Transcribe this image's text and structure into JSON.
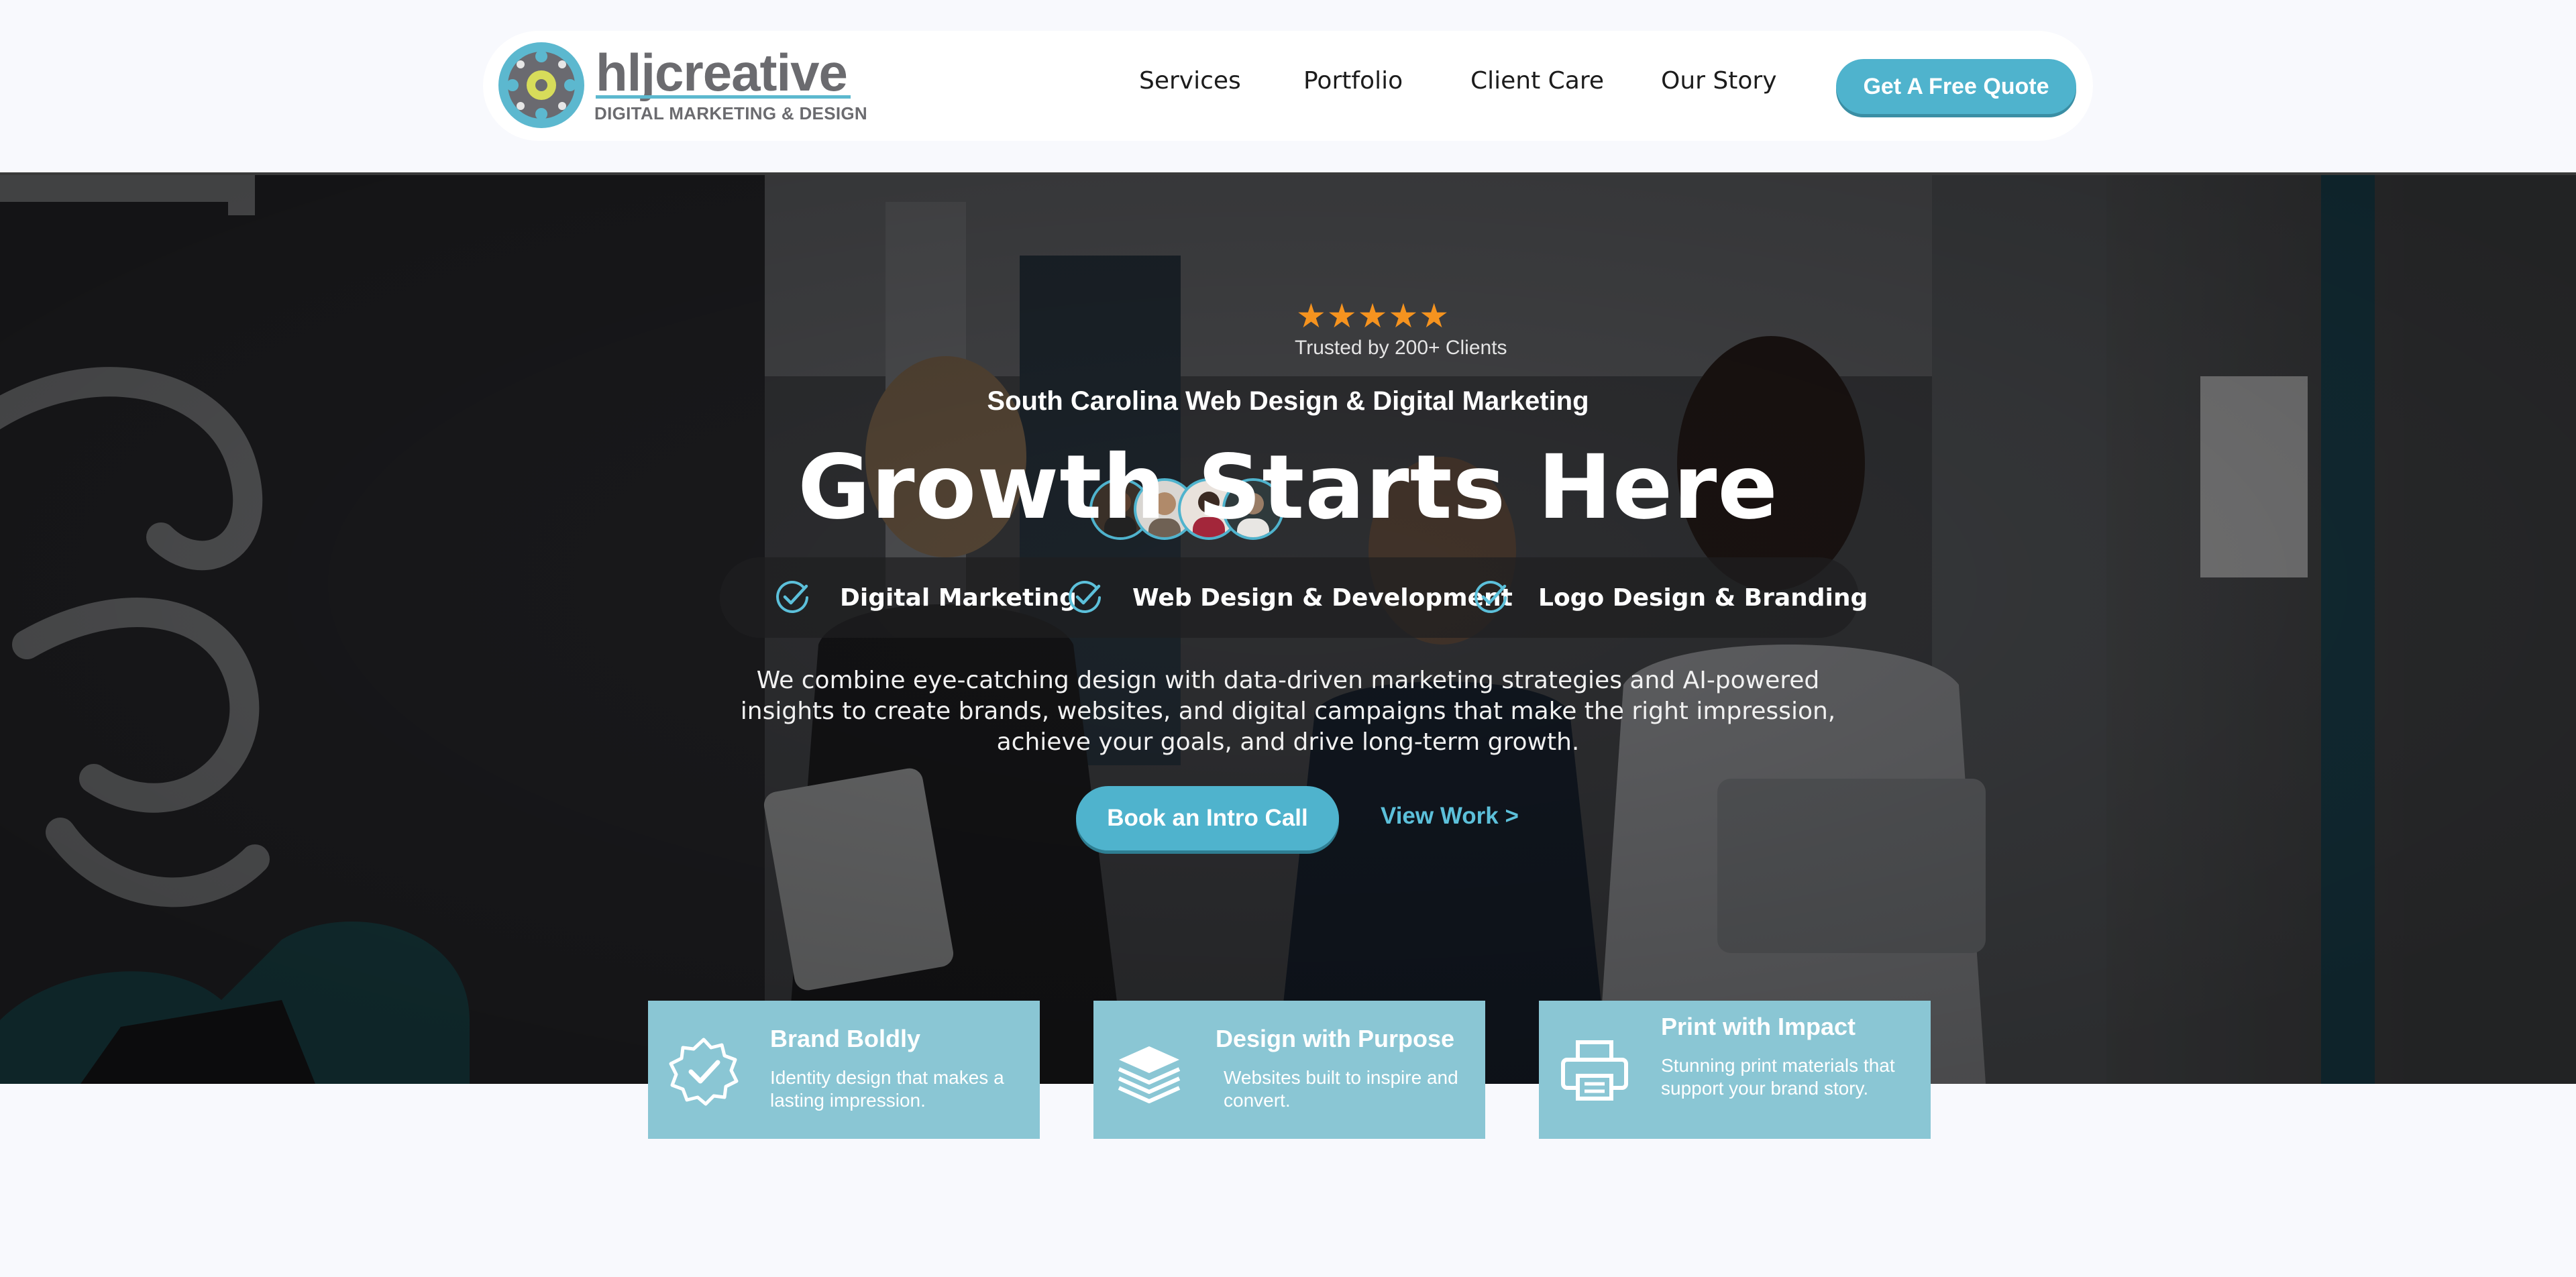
{
  "brand": {
    "name": "hljcreative",
    "tagline": "DIGITAL MARKETING & DESIGN",
    "accent_color": "#4fb3cd",
    "logo_icon": "film-reel-logo-icon"
  },
  "nav": {
    "items": [
      {
        "label": "Services"
      },
      {
        "label": "Portfolio"
      },
      {
        "label": "Client Care"
      },
      {
        "label": "Our Story"
      }
    ],
    "cta_label": "Get A Free Quote"
  },
  "hero": {
    "rating": {
      "stars": 5,
      "star_glyphs": "★★★★★",
      "label": "Trusted by 200+ Clients",
      "avatar_count": 4
    },
    "eyebrow": "South Carolina Web Design & Digital Marketing",
    "headline": "Growth Starts Here",
    "services": [
      {
        "label": "Digital Marketing",
        "icon": "check-circle-icon"
      },
      {
        "label": "Web Design & Development",
        "icon": "check-circle-icon"
      },
      {
        "label": "Logo Design & Branding",
        "icon": "check-circle-icon"
      }
    ],
    "description": "We combine eye-catching design with data-driven marketing strategies and AI-powered insights to create brands, websites, and digital campaigns that make the right impression, achieve your goals, and drive long-term growth.",
    "primary_cta": "Book an Intro Call",
    "secondary_cta": "View Work >"
  },
  "features": [
    {
      "title": "Brand Boldly",
      "text": "Identity design that makes a lasting impression.",
      "icon": "badge-check-icon"
    },
    {
      "title": "Design with Purpose",
      "text": "Websites built to inspire and convert.",
      "icon": "layers-stack-icon"
    },
    {
      "title": "Print with Impact",
      "text": "Stunning print materials that support your brand story.",
      "icon": "printer-icon"
    }
  ]
}
